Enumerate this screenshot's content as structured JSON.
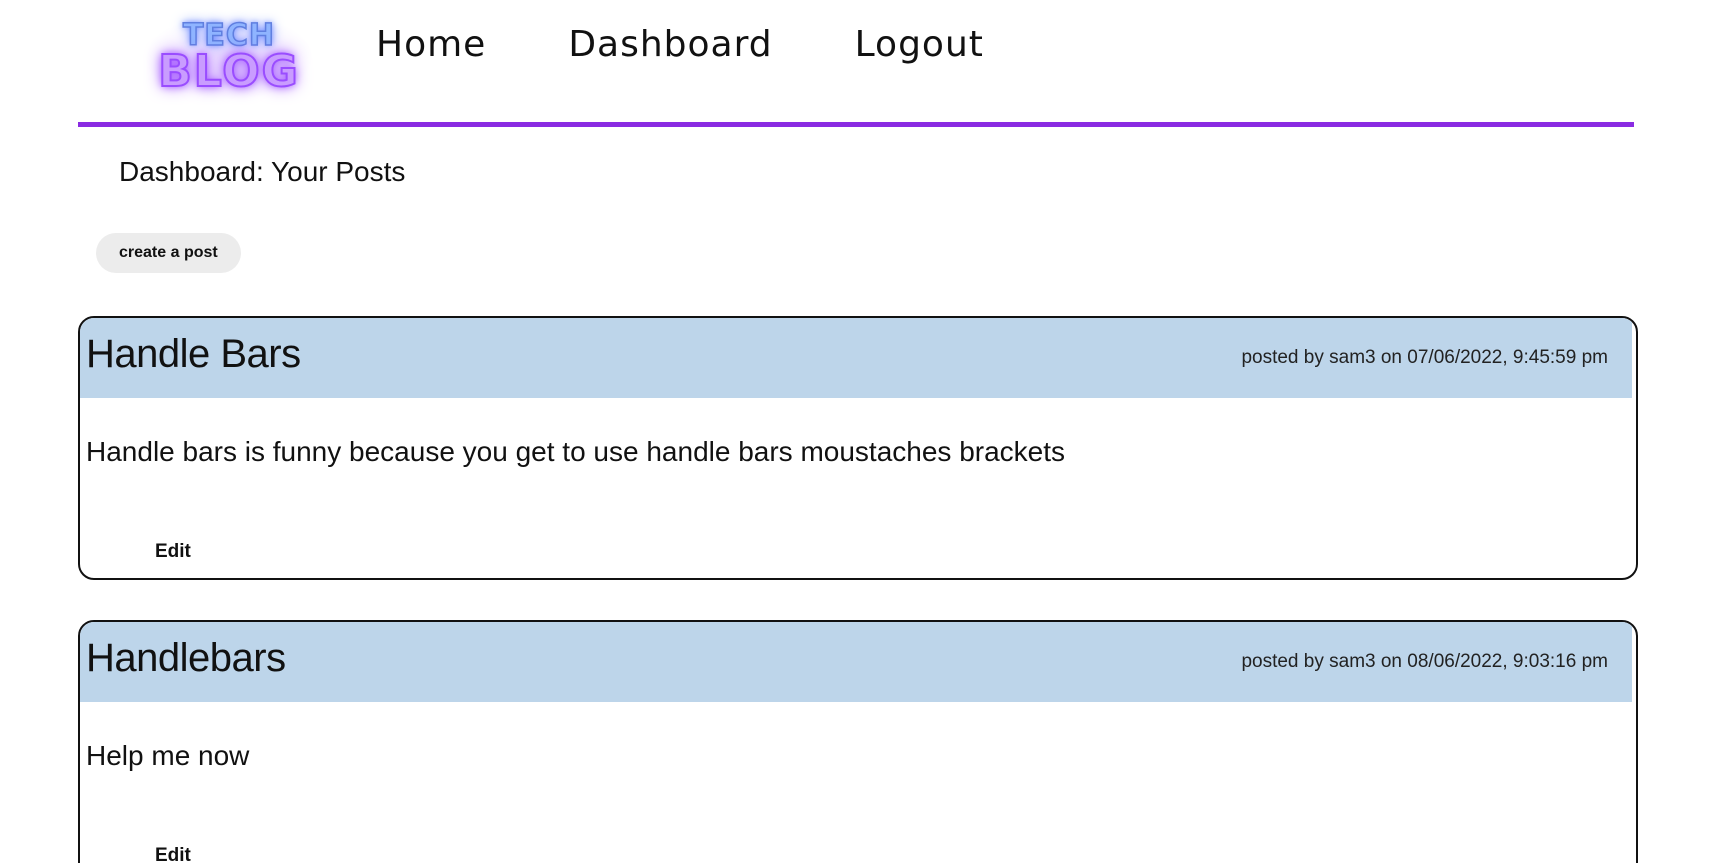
{
  "header": {
    "logo": {
      "line1": "TECH",
      "line2": "BLOG"
    },
    "nav": {
      "home": "Home",
      "dashboard": "Dashboard",
      "logout": "Logout"
    },
    "accent_color": "#8a2be2"
  },
  "main": {
    "title": "Dashboard: Your Posts",
    "create_button": "create a post",
    "posts": [
      {
        "title": "Handle Bars",
        "meta": "posted by sam3 on 07/06/2022, 9:45:59 pm",
        "body": "Handle bars is funny because you get to use handle bars moustaches brackets",
        "edit_label": "Edit"
      },
      {
        "title": "Handlebars",
        "meta": "posted by sam3 on 08/06/2022, 9:03:16 pm",
        "body": "Help me now",
        "edit_label": "Edit"
      }
    ],
    "post_header_color": "#bdd5ea"
  }
}
